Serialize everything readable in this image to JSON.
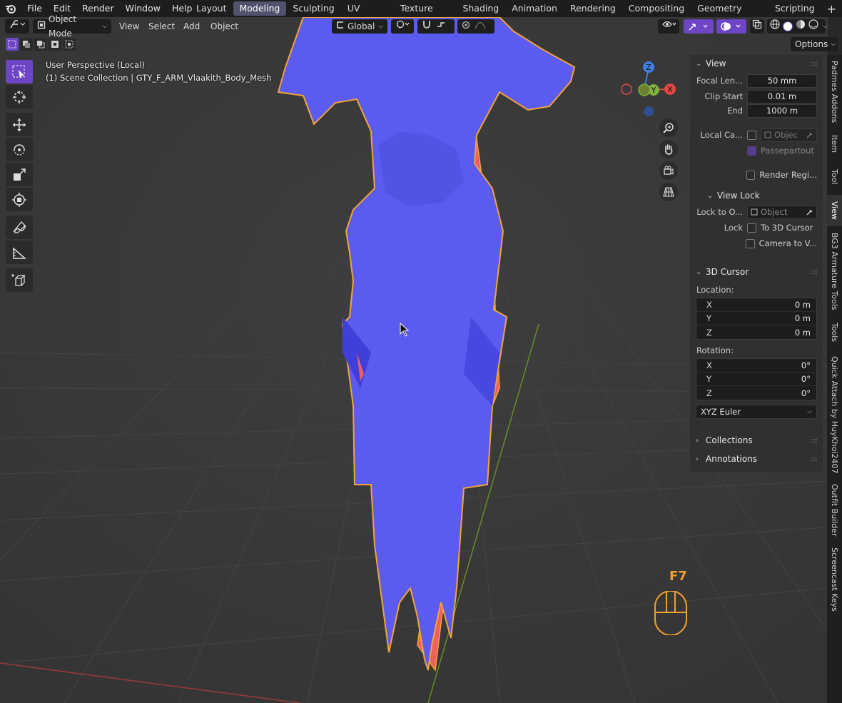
{
  "topbar": {
    "menus": [
      "File",
      "Edit",
      "Render",
      "Window",
      "Help"
    ],
    "workspaces": [
      "Layout",
      "Modeling",
      "Sculpting",
      "UV Editing",
      "Texture Paint",
      "Shading",
      "Animation",
      "Rendering",
      "Compositing",
      "Geometry Nodes",
      "Scripting"
    ],
    "active_workspace": "Modeling",
    "add_label": "+"
  },
  "header": {
    "mode": "Object Mode",
    "menus": [
      "View",
      "Select",
      "Add",
      "Object"
    ],
    "transform_orientation": "Global",
    "options_label": "Options"
  },
  "overlay": {
    "perspective": "User Perspective (Local)",
    "collection": "(1) Scene Collection | GTY_F_ARM_Vlaakith_Body_Mesh"
  },
  "gizmo": {
    "z": "Z",
    "x": "X",
    "y": "Y"
  },
  "npanel": {
    "view": {
      "title": "View",
      "focal_label": "Focal Len...",
      "focal_value": "50 mm",
      "clip_start_label": "Clip Start",
      "clip_start_value": "0.01 m",
      "end_label": "End",
      "end_value": "1000 m",
      "local_camera_label": "Local Ca...",
      "local_camera_value": "Objec",
      "passepartout_label": "Passepartout",
      "render_region_label": "Render Regi...",
      "view_lock_title": "View Lock",
      "lock_to_label": "Lock to O...",
      "lock_to_value": "Object",
      "lock_label": "Lock",
      "to_3d_cursor_label": "To 3D Cursor",
      "camera_to_view_label": "Camera to V..."
    },
    "cursor": {
      "title": "3D Cursor",
      "location_label": "Location:",
      "loc": [
        {
          "axis": "X",
          "value": "0 m"
        },
        {
          "axis": "Y",
          "value": "0 m"
        },
        {
          "axis": "Z",
          "value": "0 m"
        }
      ],
      "rotation_label": "Rotation:",
      "rot": [
        {
          "axis": "X",
          "value": "0°"
        },
        {
          "axis": "Y",
          "value": "0°"
        },
        {
          "axis": "Z",
          "value": "0°"
        }
      ],
      "rotation_mode": "XYZ Euler"
    },
    "collections_title": "Collections",
    "annotations_title": "Annotations"
  },
  "sidetabs": [
    "Padmes Addons",
    "Item",
    "Tool",
    "View",
    "BG3 Armature Tools",
    "Tools",
    "Quick Attach by HuyKhoi2407",
    "Outfit Builder",
    "Screencast Keys"
  ],
  "active_sidetab": "View",
  "screencast": {
    "key": "F7"
  },
  "colors": {
    "mesh": "#5b5bf0",
    "mesh_back": "#ee6060",
    "outline": "#f2a33a",
    "accent": "#6c46c4"
  }
}
